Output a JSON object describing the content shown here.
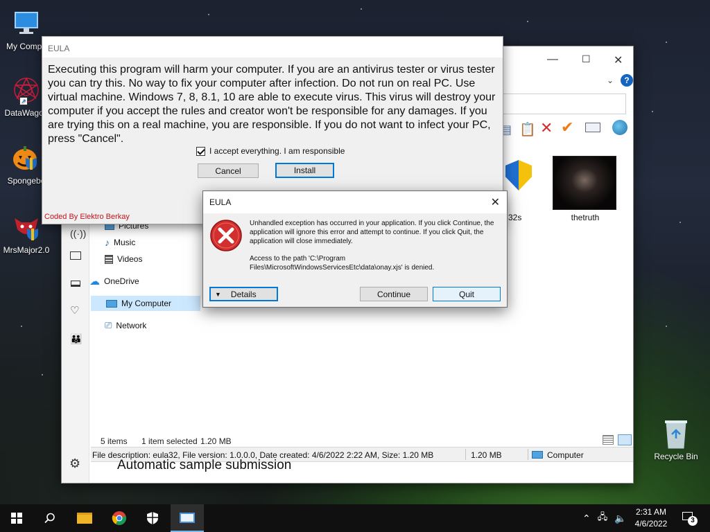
{
  "desktop": {
    "icons": [
      {
        "label": "My Compu",
        "icon": "computer-icon"
      },
      {
        "label": "DataWagon",
        "icon": "datawagon-icon"
      },
      {
        "label": "Spongebo",
        "icon": "pumpkin-icon"
      },
      {
        "label": "MrsMajor2.0",
        "icon": "mrsmajor-icon"
      },
      {
        "label": "Recycle Bin",
        "icon": "recycle-bin-icon"
      }
    ]
  },
  "explorer": {
    "files": [
      {
        "name": "32s",
        "icon": "shield-icon"
      },
      {
        "name": "thetruth",
        "icon": "image-thumb"
      }
    ],
    "nav": {
      "pictures": "Pictures",
      "music": "Music",
      "videos": "Videos",
      "onedrive": "OneDrive",
      "my_computer": "My Computer",
      "network": "Network"
    },
    "status": {
      "items": "5 items",
      "selected": "1 item selected",
      "size": "1.20 MB"
    },
    "details_bar": {
      "description": "File description: eula32, File version: 1.0.0.0, Date created: 4/6/2022 2:22 AM, Size: 1.20 MB",
      "size": "1.20 MB",
      "location": "Computer"
    },
    "behind_text": "Automatic sample submission"
  },
  "eula": {
    "title": "EULA",
    "body": "Executing this program will harm your computer. If you are an antivirus tester or virus tester you can try this. No way to fix your computer after infection. Do not run on real PC. Use virtual machine. Windows 7, 8, 8.1, 10 are able to execute virus. This virus will destroy your computer if you accept the rules and creator won't be responsible for any damages. If you are trying this on a real machine, you are responsible. If you do not want to infect your PC, press \"Cancel\".",
    "accept_label": "I accept everything. I am responsible",
    "accept_checked": true,
    "cancel_label": "Cancel",
    "install_label": "Install",
    "footer": "Coded By Elektro Berkay"
  },
  "error_dialog": {
    "title": "EULA",
    "message1": "Unhandled exception has occurred in your application. If you click Continue, the application will ignore this error and attempt to continue. If you click Quit, the application will close immediately.",
    "message2": "Access to the path 'C:\\Program Files\\MicrosoftWindowsServicesEtc\\data\\onay.xjs' is denied.",
    "details_label": "Details",
    "continue_label": "Continue",
    "quit_label": "Quit"
  },
  "taskbar": {
    "time": "2:31 AM",
    "date": "4/6/2022",
    "notification_count": "3"
  },
  "colors": {
    "accent": "#0078d7",
    "error_red": "#d32f2f",
    "footer_red": "#c0141a"
  }
}
